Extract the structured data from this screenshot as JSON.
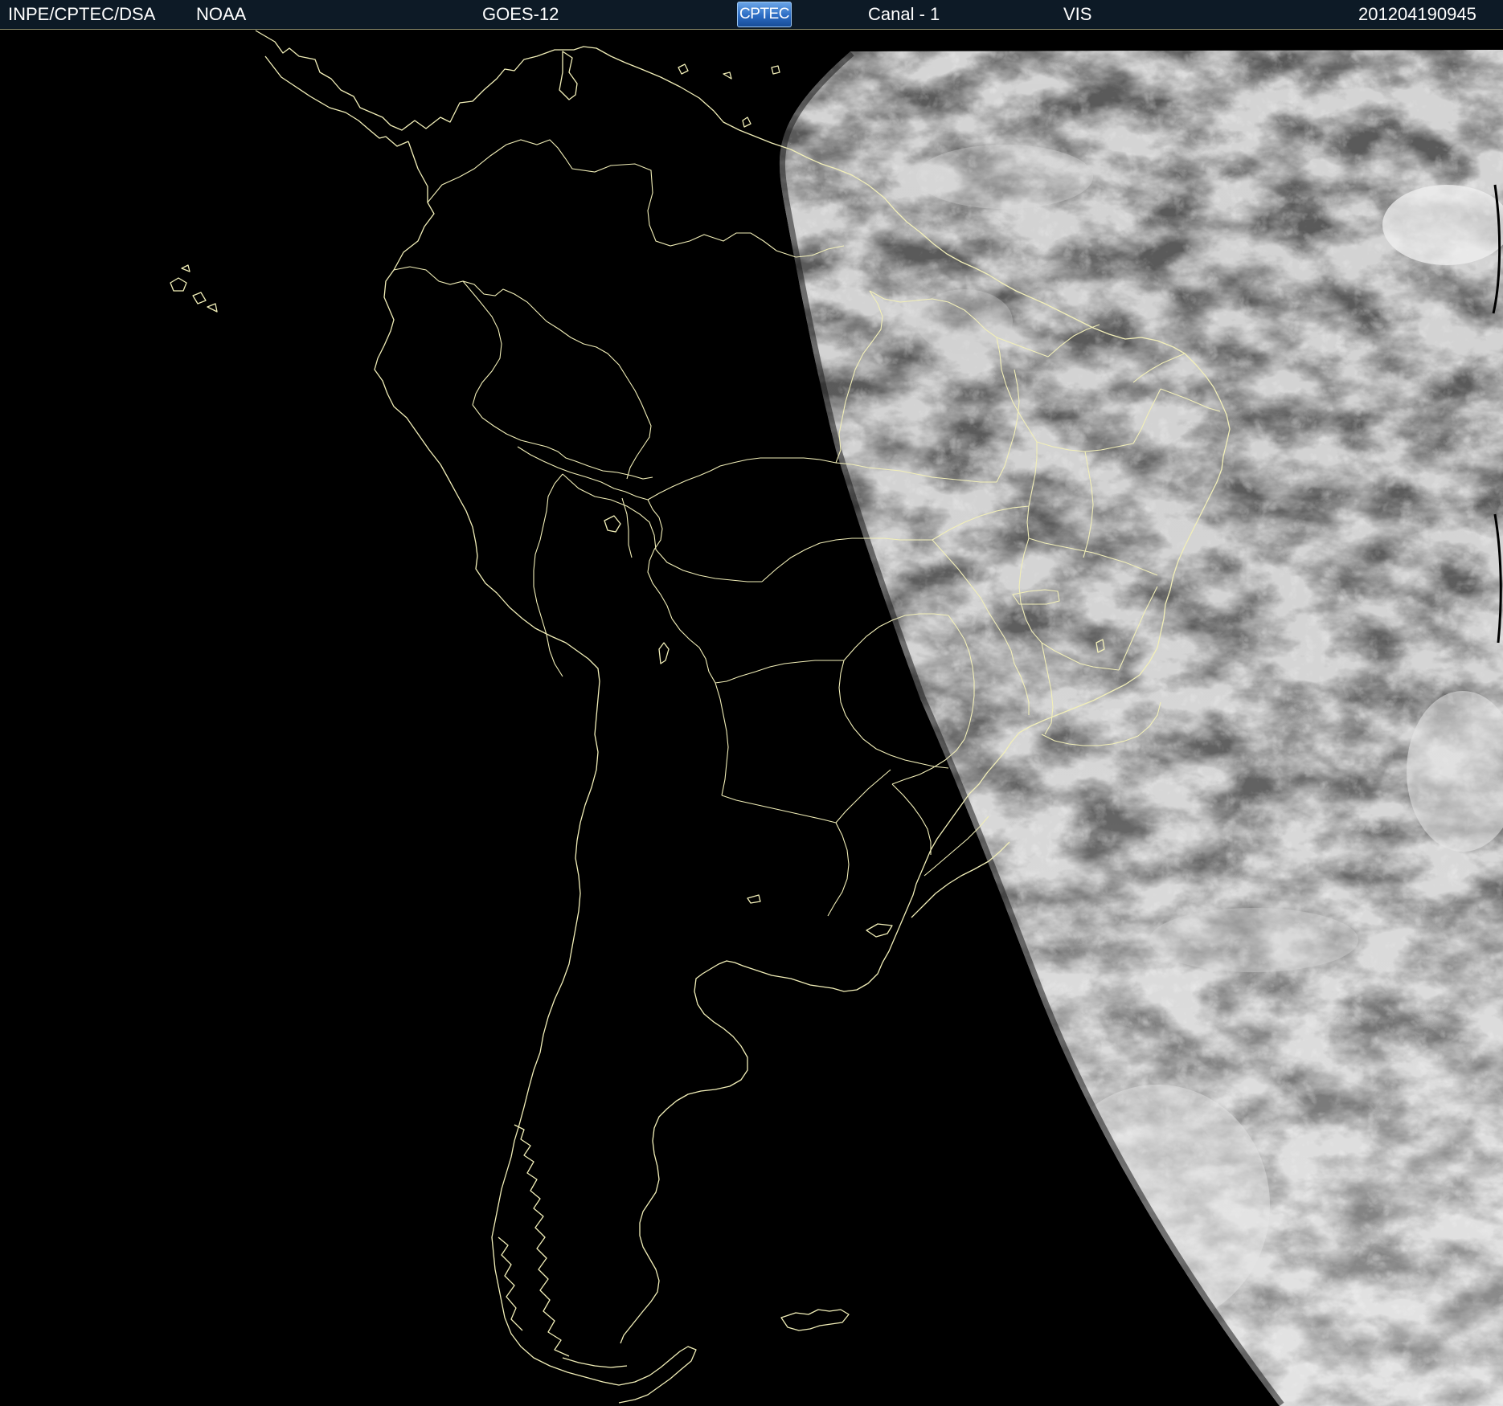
{
  "header": {
    "agency": "INPE/CPTEC/DSA",
    "operator": "NOAA",
    "satellite": "GOES-12",
    "logo_text": "CPTEC",
    "channel": "Canal - 1",
    "band": "VIS",
    "datetime": "201204190945"
  },
  "colors": {
    "background": "#000000",
    "header_background": "#0d1a26",
    "outline": "#f2efb8",
    "cloud_gray": "#6b6b6b"
  },
  "icons": {
    "logo": "cptec-logo"
  }
}
